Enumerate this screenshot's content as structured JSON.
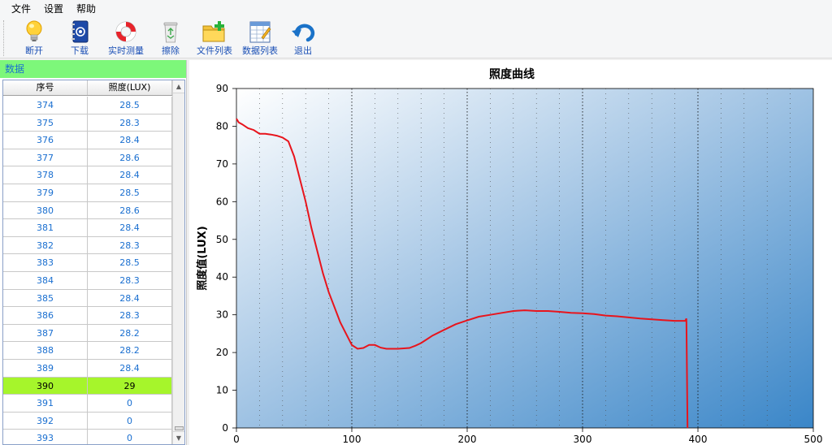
{
  "menu": [
    "文件",
    "设置",
    "帮助"
  ],
  "toolbar": {
    "items": [
      {
        "label": "断开",
        "icon": "lightbulb-icon"
      },
      {
        "label": "下载",
        "icon": "address-book-icon"
      },
      {
        "label": "实时测量",
        "icon": "lifebuoy-icon"
      },
      {
        "label": "擦除",
        "icon": "recycle-bin-icon"
      },
      {
        "label": "文件列表",
        "icon": "folder-add-icon"
      },
      {
        "label": "数据列表",
        "icon": "spreadsheet-icon"
      },
      {
        "label": "退出",
        "icon": "undo-arrow-icon"
      }
    ]
  },
  "data_panel": {
    "title": "数据",
    "columns": [
      "序号",
      "照度(LUX)"
    ],
    "rows": [
      [
        "374",
        "28.5"
      ],
      [
        "375",
        "28.3"
      ],
      [
        "376",
        "28.4"
      ],
      [
        "377",
        "28.6"
      ],
      [
        "378",
        "28.4"
      ],
      [
        "379",
        "28.5"
      ],
      [
        "380",
        "28.6"
      ],
      [
        "381",
        "28.4"
      ],
      [
        "382",
        "28.3"
      ],
      [
        "383",
        "28.5"
      ],
      [
        "384",
        "28.3"
      ],
      [
        "385",
        "28.4"
      ],
      [
        "386",
        "28.3"
      ],
      [
        "387",
        "28.2"
      ],
      [
        "388",
        "28.2"
      ],
      [
        "389",
        "28.4"
      ],
      [
        "390",
        "29"
      ],
      [
        "391",
        "0"
      ],
      [
        "392",
        "0"
      ],
      [
        "393",
        "0"
      ]
    ],
    "selected_row": "390",
    "selected_color": "#a6f52b"
  },
  "chart_data": {
    "type": "line",
    "title": "照度曲线",
    "xlabel": "",
    "ylabel": "照度值(LUX)",
    "xlim": [
      0,
      500
    ],
    "ylim": [
      0,
      90
    ],
    "x_ticks": [
      0,
      100,
      200,
      300,
      400,
      500
    ],
    "y_ticks": [
      0,
      10,
      20,
      30,
      40,
      50,
      60,
      70,
      80,
      90
    ],
    "grid": "vertical dotted",
    "line_color": "#e8141c",
    "series": [
      {
        "x": [
          0,
          2,
          5,
          10,
          15,
          20,
          25,
          30,
          35,
          40,
          45,
          50,
          55,
          60,
          65,
          70,
          75,
          80,
          85,
          90,
          95,
          100,
          105,
          110,
          115,
          120,
          125,
          130,
          140,
          150,
          155,
          160,
          165,
          170,
          180,
          190,
          200,
          210,
          220,
          230,
          240,
          250,
          260,
          270,
          280,
          290,
          300,
          310,
          320,
          330,
          340,
          350,
          360,
          370,
          380,
          389,
          390,
          391
        ],
        "y": [
          82,
          81,
          80.5,
          79.5,
          79,
          78,
          78,
          77.8,
          77.5,
          77,
          76,
          72,
          66,
          60,
          53,
          47,
          41,
          36,
          32,
          28,
          25,
          22,
          21,
          21.2,
          22,
          22,
          21.3,
          21,
          21,
          21.2,
          21.8,
          22.5,
          23.5,
          24.5,
          26,
          27.5,
          28.5,
          29.5,
          30,
          30.5,
          31,
          31.2,
          31,
          31,
          30.8,
          30.5,
          30.4,
          30.2,
          29.8,
          29.6,
          29.3,
          29,
          28.8,
          28.6,
          28.4,
          28.4,
          29,
          0
        ]
      }
    ]
  }
}
